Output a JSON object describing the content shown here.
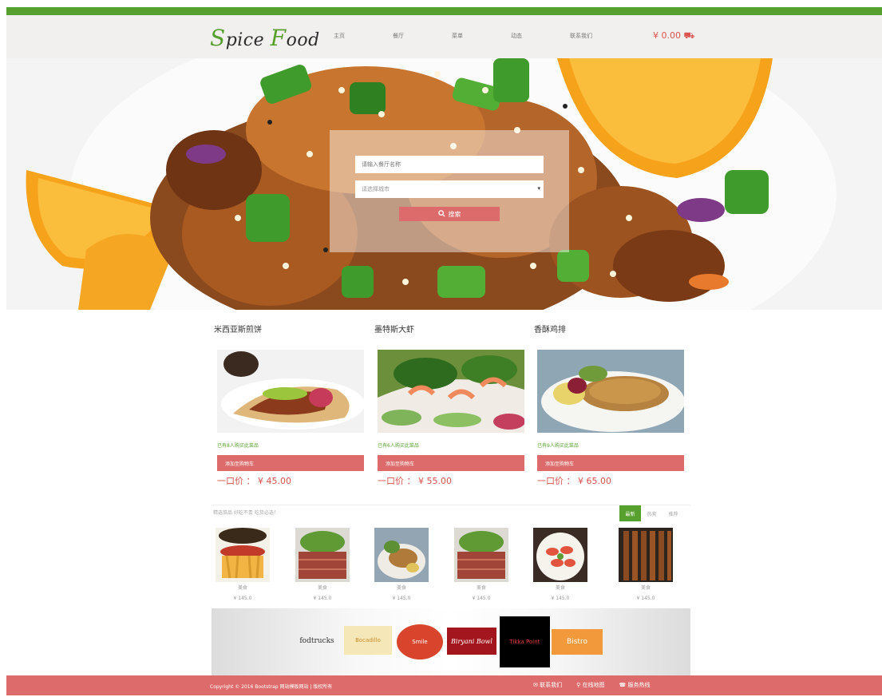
{
  "header": {
    "logo": {
      "letter1": "S",
      "part1": "pice",
      "letter2": "F",
      "part2": "ood"
    },
    "nav": [
      "主页",
      "餐厅",
      "菜单",
      "动态",
      "联系我们"
    ],
    "cart_amount": "¥ 0.00"
  },
  "hero": {
    "search_placeholder": "请输入餐厅名称",
    "select_value": "请选择城市",
    "search_button": "搜索"
  },
  "dishes": [
    {
      "title": "米西亚斯煎饼",
      "note": "已有8人购买此菜品",
      "button": "添加至购物车",
      "price": "一口价 ： ¥ 45.00"
    },
    {
      "title": "墨特斯大虾",
      "note": "已有6人购买此菜品",
      "button": "添加至购物车",
      "price": "一口价 ： ¥ 55.00"
    },
    {
      "title": "香酥鸡排",
      "note": "已有9人购买此菜品",
      "button": "添加至购物车",
      "price": "一口价 ： ¥ 65.00"
    }
  ],
  "products_section": {
    "title": "精选菜品 好吃不贵 吃货必选！",
    "tabs": [
      "最新",
      "热卖",
      "推荐"
    ],
    "items": [
      {
        "name": "美食",
        "price": "¥ 145.0"
      },
      {
        "name": "美食",
        "price": "¥ 145.0"
      },
      {
        "name": "美食",
        "price": "¥ 145.0"
      },
      {
        "name": "美食",
        "price": "¥ 145.0"
      },
      {
        "name": "美食",
        "price": "¥ 145.0"
      },
      {
        "name": "美食",
        "price": "¥ 145.0"
      }
    ]
  },
  "partners": [
    "fodtrucks",
    "Bocadillo",
    "Smile",
    "Biryani Bowl",
    "Tikka Point",
    "Bistro"
  ],
  "footer": {
    "copyright": "Copyright © 2016 Bootstrap 网站模板网站 | 版权所有",
    "links": [
      "联系我们",
      "在线地图",
      "服务热线"
    ]
  },
  "colors": {
    "accent_green": "#58a02e",
    "accent_red": "#de6b6b",
    "price_red": "#d9534f"
  }
}
